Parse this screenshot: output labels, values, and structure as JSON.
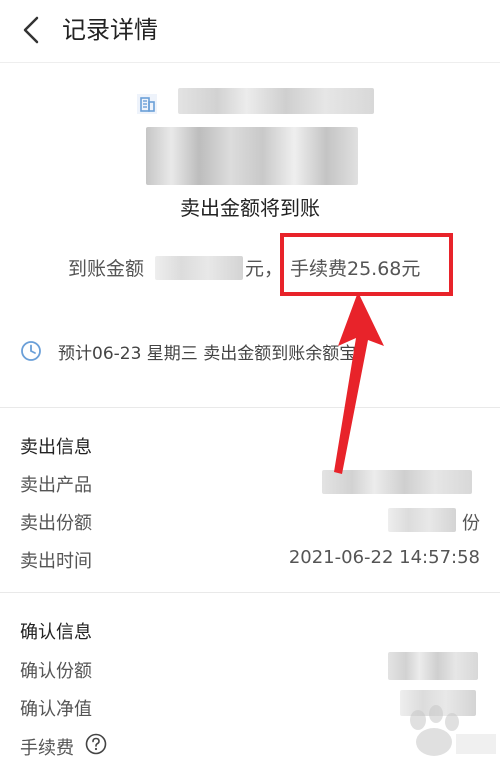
{
  "header": {
    "title": "记录详情"
  },
  "summary": {
    "status": "卖出金额将到账",
    "amount_label": "到账金额",
    "amount_unit": "元，",
    "fee_text": "手续费25.68元",
    "expected_text": "预计06-23 星期三  卖出金额到账余额宝"
  },
  "sell_info": {
    "title": "卖出信息",
    "rows": [
      {
        "label": "卖出产品",
        "value": ""
      },
      {
        "label": "卖出份额",
        "value": "份"
      },
      {
        "label": "卖出时间",
        "value": "2021-06-22 14:57:58"
      }
    ]
  },
  "confirm_info": {
    "title": "确认信息",
    "rows": [
      {
        "label": "确认份额",
        "value": ""
      },
      {
        "label": "确认净值",
        "value": ""
      },
      {
        "label": "手续费",
        "value": ""
      }
    ]
  },
  "colors": {
    "highlight": "#e8232a",
    "icon_blue": "#6a9fd8"
  },
  "icons": {
    "back": "chevron-left-icon",
    "product": "building-icon",
    "clock": "clock-icon",
    "help": "question-circle-icon"
  }
}
